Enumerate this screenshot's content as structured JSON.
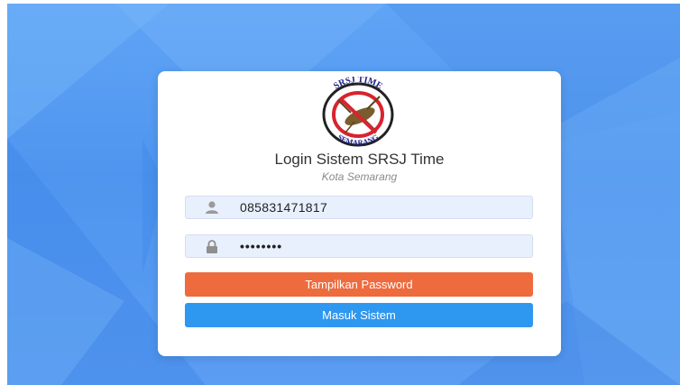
{
  "colors": {
    "background_blue": "#5a9df2",
    "card": "#ffffff",
    "input_fill": "#e8f0fe",
    "show_password_button": "#ee6b3d",
    "login_button": "#2e97f0"
  },
  "login": {
    "logo": {
      "text_top": "SRSJ TIME",
      "text_bottom": "SEMARANG",
      "icon": "no-mosquito-icon"
    },
    "title": "Login Sistem SRSJ Time",
    "subtitle": "Kota Semarang",
    "username": {
      "icon": "user-icon",
      "value": "085831471817"
    },
    "password": {
      "icon": "lock-icon",
      "value": "••••••••"
    },
    "show_password_label": "Tampilkan Password",
    "login_label": "Masuk Sistem"
  }
}
